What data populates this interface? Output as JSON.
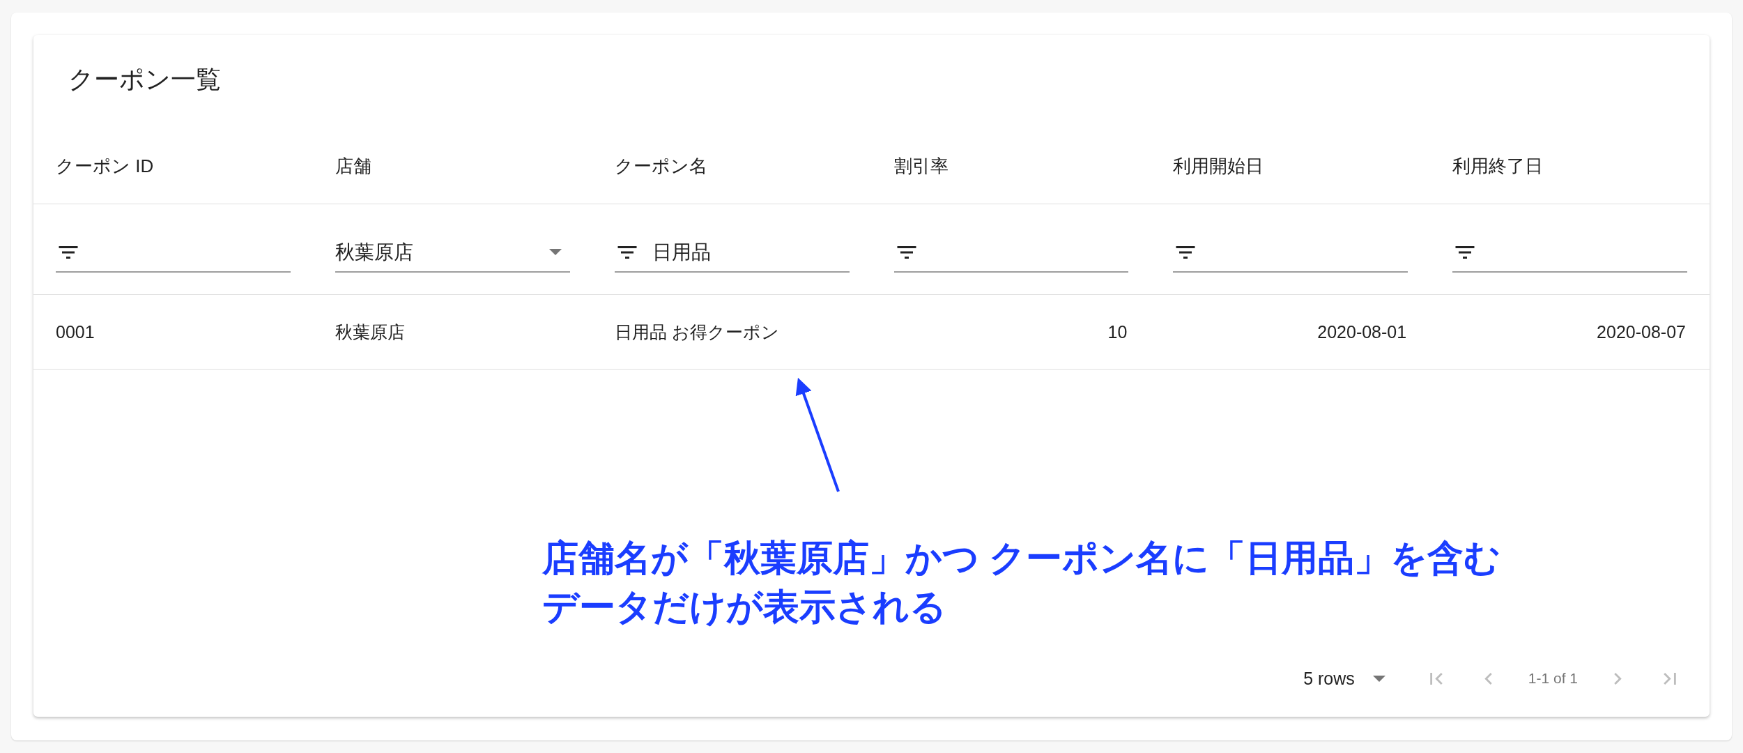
{
  "title": "クーポン一覧",
  "table": {
    "columns": [
      {
        "label": "クーポン ID",
        "numeric": false
      },
      {
        "label": "店舗",
        "numeric": false
      },
      {
        "label": "クーポン名",
        "numeric": false
      },
      {
        "label": "割引率",
        "numeric": true
      },
      {
        "label": "利用開始日",
        "numeric": true
      },
      {
        "label": "利用終了日",
        "numeric": true
      }
    ],
    "filters": [
      {
        "kind": "text"
      },
      {
        "kind": "select",
        "value": "秋葉原店"
      },
      {
        "kind": "text",
        "value": "日用品"
      },
      {
        "kind": "text"
      },
      {
        "kind": "text"
      },
      {
        "kind": "text"
      }
    ],
    "rows": [
      [
        "0001",
        "秋葉原店",
        "日用品 お得クーポン",
        "10",
        "2020-08-01",
        "2020-08-07"
      ]
    ]
  },
  "pagination": {
    "rows_per_page": "5 rows",
    "range": "1-1 of 1",
    "buttons": [
      {
        "kind": "first",
        "disabled": true
      },
      {
        "kind": "prev",
        "disabled": true
      },
      {
        "kind": "next",
        "disabled": true
      },
      {
        "kind": "last",
        "disabled": true
      }
    ]
  },
  "annotation": {
    "lines": [
      "店舗名が「秋葉原店」かつ クーポン名に「日用品」を含む",
      "データだけが表示される"
    ]
  }
}
